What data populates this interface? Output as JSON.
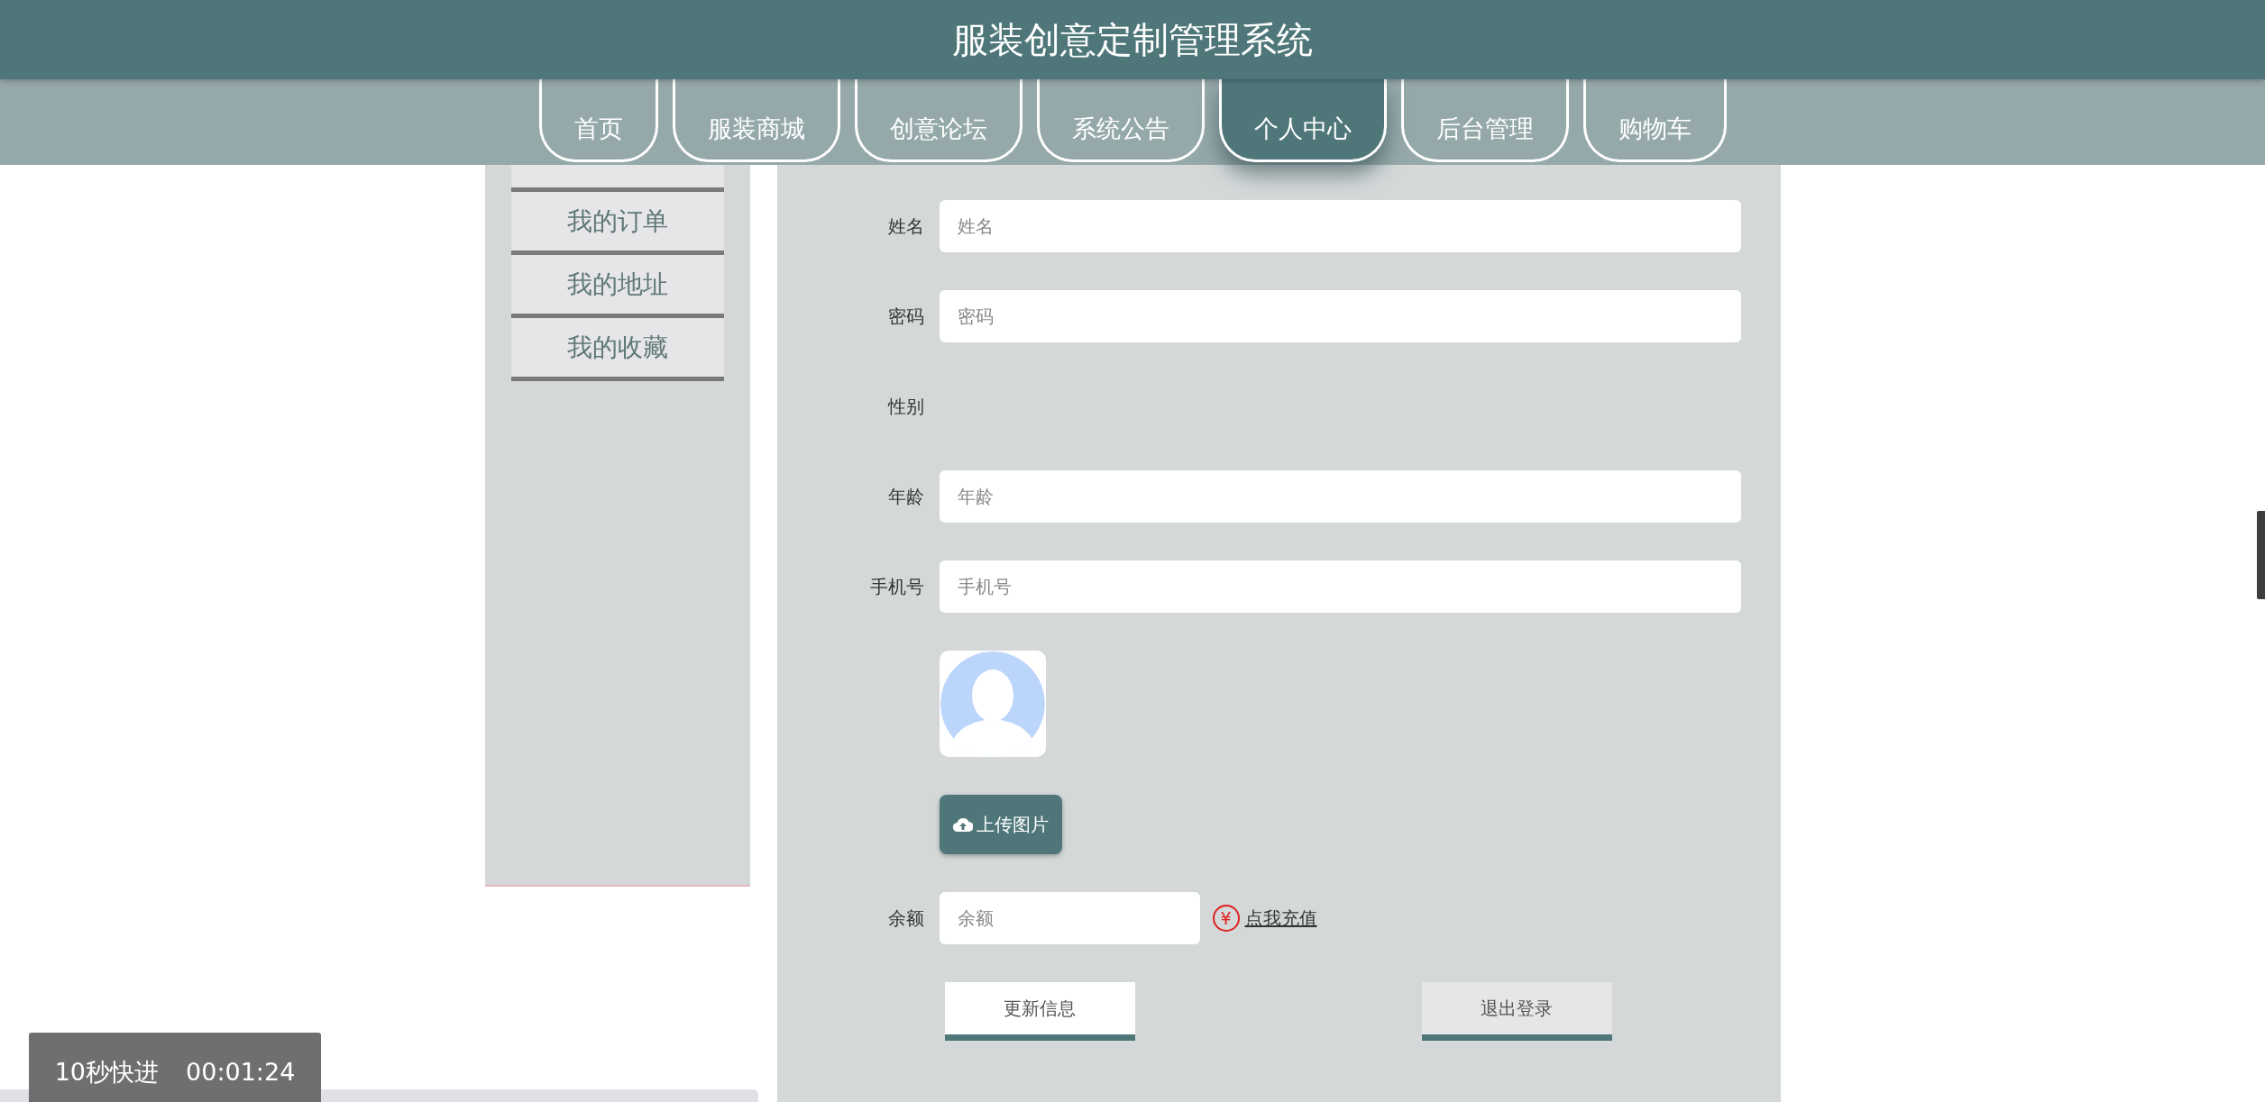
{
  "header": {
    "title": "服装创意定制管理系统"
  },
  "nav": [
    {
      "label": "首页",
      "selected": false
    },
    {
      "label": "服装商城",
      "selected": false
    },
    {
      "label": "创意论坛",
      "selected": false
    },
    {
      "label": "系统公告",
      "selected": false
    },
    {
      "label": "个人中心",
      "selected": true
    },
    {
      "label": "后台管理",
      "selected": false
    },
    {
      "label": "购物车",
      "selected": false
    }
  ],
  "sidebar": {
    "items": [
      {
        "label": "我的订单"
      },
      {
        "label": "我的地址"
      },
      {
        "label": "我的收藏"
      }
    ]
  },
  "form": {
    "fields": [
      {
        "kind": "text",
        "label": "姓名",
        "placeholder": "姓名"
      },
      {
        "kind": "text",
        "label": "密码",
        "placeholder": "密码"
      },
      {
        "kind": "empty",
        "label": "性别"
      },
      {
        "kind": "text",
        "label": "年龄",
        "placeholder": "年龄"
      },
      {
        "kind": "text",
        "label": "手机号",
        "placeholder": "手机号"
      },
      {
        "kind": "avatar"
      },
      {
        "kind": "upload",
        "button": "上传图片"
      },
      {
        "kind": "balance",
        "label": "余额",
        "placeholder": "余额",
        "icon": "¥",
        "link": "点我充值"
      }
    ],
    "buttons": [
      {
        "label": "更新信息",
        "kind": "highlighted"
      },
      {
        "label": "退出登录",
        "kind": "plain"
      }
    ]
  },
  "player_toast": {
    "label": "10秒快进",
    "time": "00:01:24"
  }
}
